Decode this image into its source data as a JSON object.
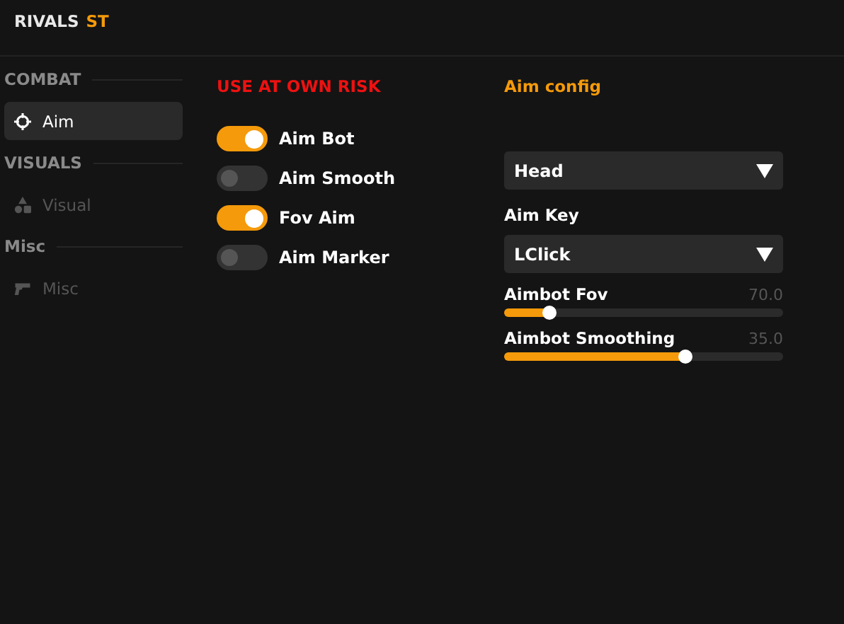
{
  "window": {
    "title": "RIVALS",
    "title_suffix": "ST"
  },
  "sidebar": {
    "sections": [
      {
        "title": "COMBAT",
        "items": [
          {
            "label": "Aim",
            "selected": true
          }
        ]
      },
      {
        "title": "VISUALS",
        "items": [
          {
            "label": "Visual",
            "selected": false
          }
        ]
      },
      {
        "title": "Misc",
        "items": [
          {
            "label": "Misc",
            "selected": false
          }
        ]
      }
    ]
  },
  "warning": "USE AT OWN RISK",
  "toggles": [
    {
      "label": "Aim Bot",
      "on": true
    },
    {
      "label": "Aim Smooth",
      "on": false
    },
    {
      "label": "Fov Aim",
      "on": true
    },
    {
      "label": "Aim Marker",
      "on": false
    }
  ],
  "config": {
    "title": "Aim config",
    "controls": [
      {
        "kind": "dropdown",
        "value": "Head"
      },
      {
        "kind": "dropdown",
        "label": "Aim Key",
        "value": "LClick"
      },
      {
        "kind": "slider",
        "label": "Aimbot Fov",
        "reading": "70.0",
        "level": 0.16
      },
      {
        "kind": "slider",
        "label": "Aimbot Smoothing",
        "reading": "35.0",
        "level": 0.65
      }
    ]
  }
}
